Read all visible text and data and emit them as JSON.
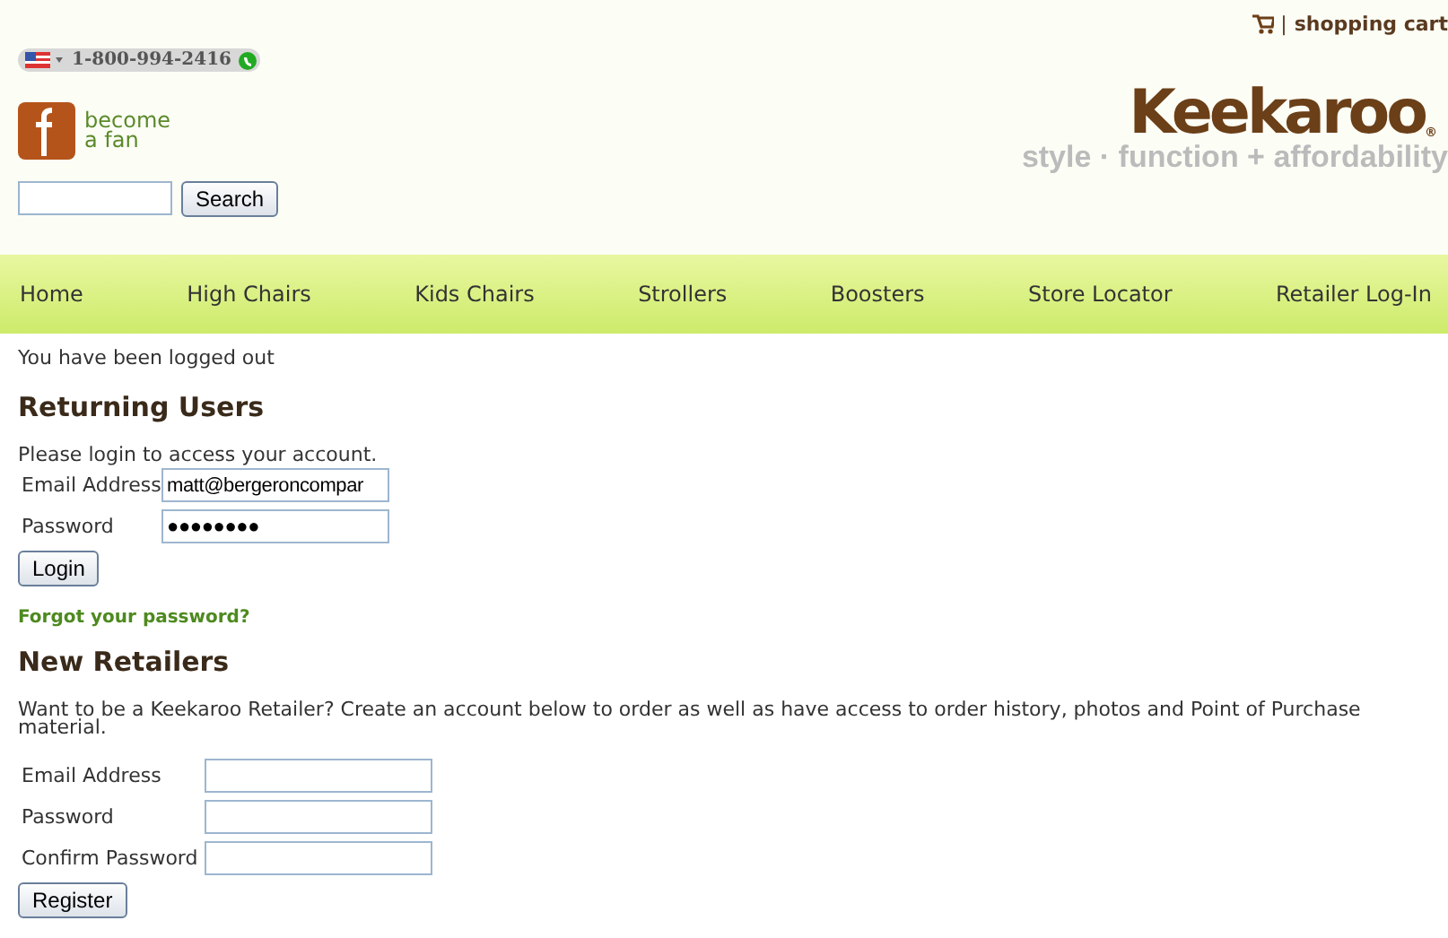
{
  "header": {
    "phone": "1-800-994-2416",
    "fan_label": [
      "become",
      "a fan"
    ],
    "search_button": "Search",
    "cart_link": "shopping cart",
    "cart_separator": "|",
    "logo": "Keekaroo",
    "logo_mark": "®",
    "tagline": "style · function + affordability"
  },
  "nav": [
    {
      "label": "Home"
    },
    {
      "label": "High Chairs"
    },
    {
      "label": "Kids Chairs"
    },
    {
      "label": "Strollers"
    },
    {
      "label": "Boosters"
    },
    {
      "label": "Store Locator"
    },
    {
      "label": "Retailer Log-In"
    }
  ],
  "status_message": "You have been logged out",
  "returning": {
    "title": "Returning Users",
    "intro": "Please login to access your account.",
    "fields": [
      {
        "label": "Email Address",
        "value": "matt@bergeroncompar"
      },
      {
        "label": "Password",
        "value": "●●●●●●●●"
      }
    ],
    "button": "Login",
    "forgot_link": "Forgot your password?"
  },
  "new_retailers": {
    "title": "New Retailers",
    "intro": "Want to be a Keekaroo Retailer? Create an account below to order as well as have access to order history, photos and Point of Purchase material.",
    "fields": [
      {
        "label": "Email Address"
      },
      {
        "label": "Password"
      },
      {
        "label": "Confirm Password"
      }
    ],
    "button": "Register"
  }
}
